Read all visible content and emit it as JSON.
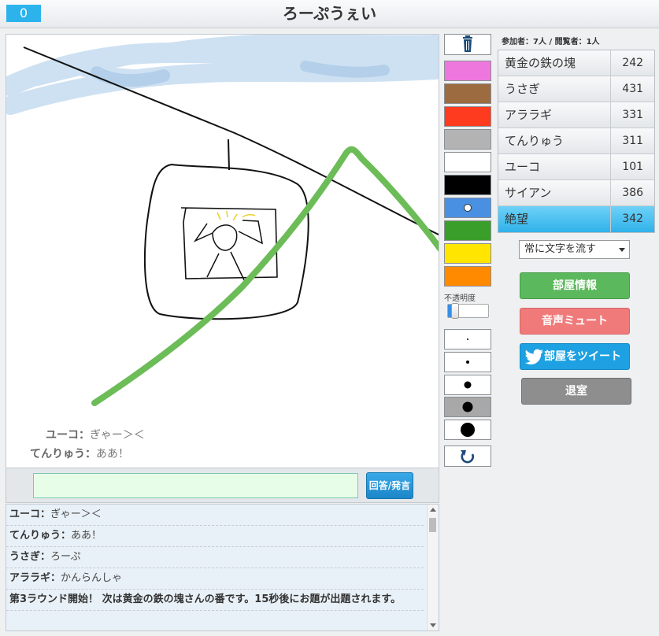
{
  "header": {
    "timer": "0",
    "title": "ろーぷうぇい"
  },
  "canvas": {
    "overlay_chat": [
      {
        "who": "ユーコ：",
        "text": "ぎゃー＞＜"
      },
      {
        "who": "てんりゅう：",
        "text": "ああ！"
      }
    ]
  },
  "input": {
    "value": "",
    "send_label": "回答/発言"
  },
  "log": [
    {
      "who": "ユーコ：",
      "text": "ぎゃー＞＜"
    },
    {
      "who": "てんりゅう：",
      "text": "ああ！"
    },
    {
      "who": "うさぎ：",
      "text": "ろーぷ"
    },
    {
      "who": "アララギ：",
      "text": "かんらんしゃ"
    }
  ],
  "log_system": "第3ラウンド開始！ 次は黄金の鉄の塊さんの番です。15秒後にお題が出題されます。",
  "tools": {
    "colors": [
      "#ee77dd",
      "#9c6b3f",
      "#ff3b1f",
      "#b3b3b3",
      "#ffffff",
      "#000000",
      "#4a90e2",
      "#3a9e2a",
      "#ffe500",
      "#ff8a00"
    ],
    "opacity_label": "不透明度",
    "opacity_value": 0.1,
    "pen_sizes": [
      2,
      4,
      9,
      13,
      18
    ],
    "active_pen_index": 3
  },
  "room": {
    "viewers": "参加者：7人 / 閲覧者：1人",
    "players": [
      {
        "name": "黄金の鉄の塊",
        "score": "242"
      },
      {
        "name": "うさぎ",
        "score": "431"
      },
      {
        "name": "アララギ",
        "score": "331"
      },
      {
        "name": "てんりゅう",
        "score": "311"
      },
      {
        "name": "ユーコ",
        "score": "101"
      },
      {
        "name": "サイアン",
        "score": "386"
      },
      {
        "name": "絶望",
        "score": "342"
      }
    ],
    "active_player_index": 6,
    "mode_select": "常に文字を流す",
    "buttons": {
      "info": "部屋情報",
      "mute": "音声ミュート",
      "tweet": "部屋をツイート",
      "exit": "退室"
    }
  }
}
